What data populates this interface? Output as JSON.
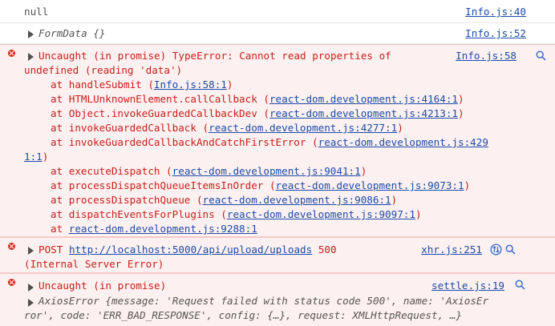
{
  "rows": {
    "r1": {
      "text": "null",
      "source": "Info.js:40"
    },
    "r2": {
      "text": "FormData {}",
      "source": "Info.js:52"
    },
    "r3": {
      "header_part1": "Uncaught (in promise) TypeError: Cannot read properties of",
      "header_part2": "undefined (reading 'data')",
      "source": "Info.js:58",
      "stack": [
        {
          "fn": "at handleSubmit (",
          "loc": "Info.js:58:1",
          "close": ")"
        },
        {
          "fn": "at HTMLUnknownElement.callCallback (",
          "loc": "react-dom.development.js:4164:1",
          "close": ")"
        },
        {
          "fn": "at Object.invokeGuardedCallbackDev (",
          "loc": "react-dom.development.js:4213:1",
          "close": ")"
        },
        {
          "fn": "at invokeGuardedCallback (",
          "loc": "react-dom.development.js:4277:1",
          "close": ")"
        },
        {
          "fn": "at invokeGuardedCallbackAndCatchFirstError (",
          "loc": "react-dom.development.js:429",
          "close": ""
        },
        {
          "fn": "",
          "loc": "1:1",
          "close": ")"
        },
        {
          "fn": "at executeDispatch (",
          "loc": "react-dom.development.js:9041:1",
          "close": ")"
        },
        {
          "fn": "at processDispatchQueueItemsInOrder (",
          "loc": "react-dom.development.js:9073:1",
          "close": ")"
        },
        {
          "fn": "at processDispatchQueue (",
          "loc": "react-dom.development.js:9086:1",
          "close": ")"
        },
        {
          "fn": "at dispatchEventsForPlugins (",
          "loc": "react-dom.development.js:9097:1",
          "close": ")"
        },
        {
          "fn": "at ",
          "loc": "react-dom.development.js:9288:1",
          "close": ""
        }
      ]
    },
    "r4": {
      "method": "POST",
      "url": "http://localhost:5000/api/upload/uploads",
      "status": "500",
      "status_text": "(Internal Server Error)",
      "source": "xhr.js:251"
    },
    "r5": {
      "header": "Uncaught (in promise)",
      "source": "settle.js:19",
      "line1": "AxiosError {message: 'Request failed with status code 500', name: 'AxiosEr",
      "line2": "ror', code: 'ERR_BAD_RESPONSE', config: {…}, request: XMLHttpRequest, …}"
    }
  }
}
